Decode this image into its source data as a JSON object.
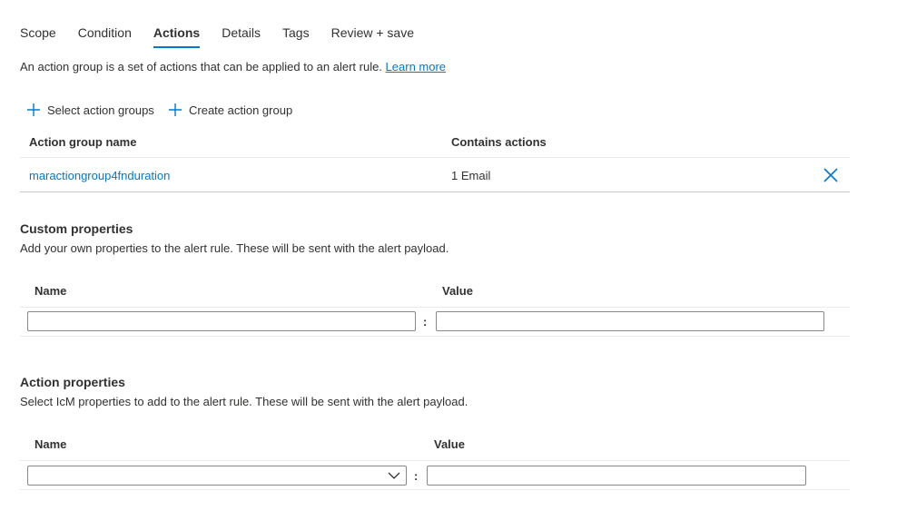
{
  "tabs": [
    {
      "label": "Scope"
    },
    {
      "label": "Condition"
    },
    {
      "label": "Actions"
    },
    {
      "label": "Details"
    },
    {
      "label": "Tags"
    },
    {
      "label": "Review + save"
    }
  ],
  "intro": {
    "text": "An action group is a set of actions that can be applied to an alert rule.",
    "link": "Learn more"
  },
  "commands": {
    "select_label": "Select action groups",
    "create_label": "Create action group"
  },
  "action_groups_table": {
    "headers": {
      "name": "Action group name",
      "actions": "Contains actions"
    },
    "rows": [
      {
        "name": "maractiongroup4fnduration",
        "actions": "1 Email"
      }
    ]
  },
  "custom_properties": {
    "title": "Custom properties",
    "description": "Add your own properties to the alert rule. These will be sent with the alert payload.",
    "name_header": "Name",
    "value_header": "Value",
    "separator": ":",
    "name_value": "",
    "value_value": ""
  },
  "action_properties": {
    "title": "Action properties",
    "description": "Select IcM properties to add to the alert rule. These will be sent with the alert payload.",
    "name_header": "Name",
    "value_header": "Value",
    "separator": ":",
    "name_selected": "",
    "value_value": ""
  },
  "colors": {
    "accent": "#0078d4",
    "text": "#323130",
    "border": "#8a8886",
    "divider": "#edebe9"
  }
}
